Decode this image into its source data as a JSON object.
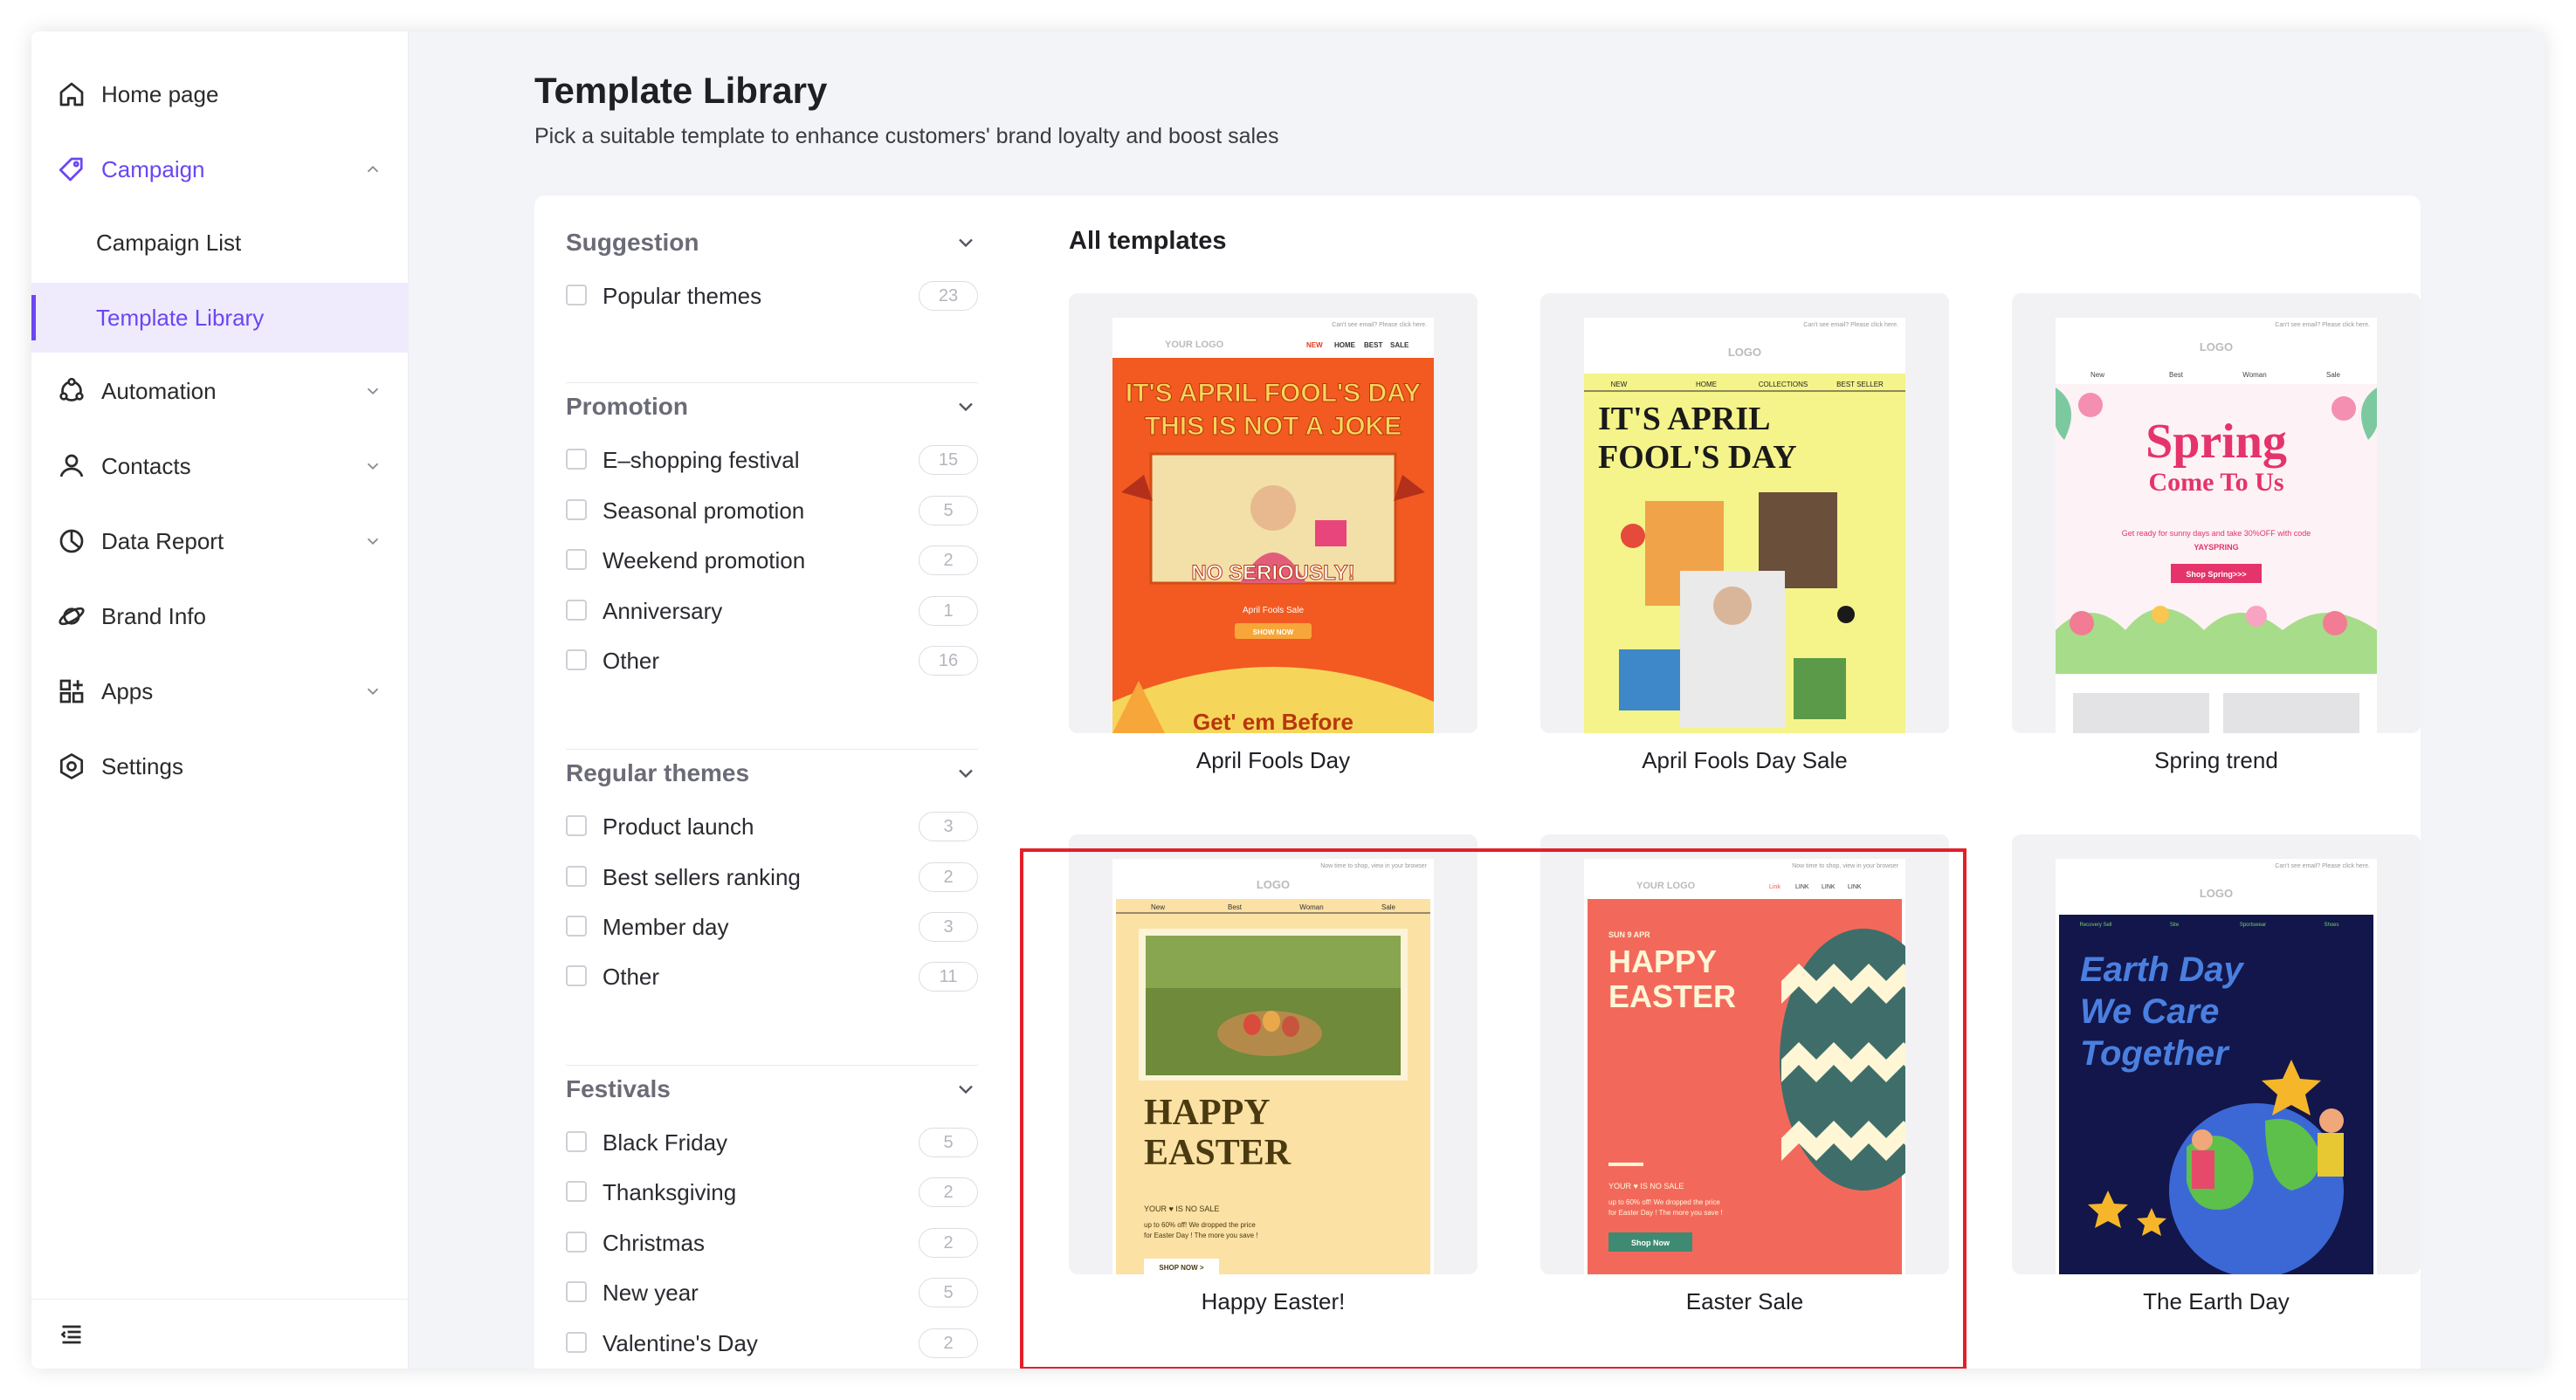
{
  "sidebar": {
    "items": [
      {
        "label": "Home page",
        "icon": "home-icon"
      },
      {
        "label": "Campaign",
        "icon": "tag-icon"
      },
      {
        "label": "Campaign List"
      },
      {
        "label": "Template Library"
      },
      {
        "label": "Automation",
        "icon": "automation-icon"
      },
      {
        "label": "Contacts",
        "icon": "user-icon"
      },
      {
        "label": "Data Report",
        "icon": "pie-chart-icon"
      },
      {
        "label": "Brand Info",
        "icon": "planet-icon"
      },
      {
        "label": "Apps",
        "icon": "apps-grid-icon"
      },
      {
        "label": "Settings",
        "icon": "gear-icon"
      }
    ],
    "accent_color": "#6b46f2"
  },
  "header": {
    "title": "Template Library",
    "subtitle": "Pick a suitable template to enhance customers' brand loyalty and boost sales"
  },
  "filters": {
    "groups": [
      {
        "title": "Suggestion",
        "options": [
          {
            "label": "Popular themes",
            "count": "23"
          }
        ]
      },
      {
        "title": "Promotion",
        "options": [
          {
            "label": "E–shopping festival",
            "count": "15"
          },
          {
            "label": "Seasonal promotion",
            "count": "5"
          },
          {
            "label": "Weekend promotion",
            "count": "2"
          },
          {
            "label": "Anniversary",
            "count": "1"
          },
          {
            "label": "Other",
            "count": "16"
          }
        ]
      },
      {
        "title": "Regular themes",
        "options": [
          {
            "label": "Product launch",
            "count": "3"
          },
          {
            "label": "Best sellers ranking",
            "count": "2"
          },
          {
            "label": "Member day",
            "count": "3"
          },
          {
            "label": "Other",
            "count": "11"
          }
        ]
      },
      {
        "title": "Festivals",
        "options": [
          {
            "label": "Black Friday",
            "count": "5"
          },
          {
            "label": "Thanksgiving",
            "count": "2"
          },
          {
            "label": "Christmas",
            "count": "2"
          },
          {
            "label": "New year",
            "count": "5"
          },
          {
            "label": "Valentine's Day",
            "count": "2"
          }
        ]
      }
    ]
  },
  "templates": {
    "section_title": "All templates",
    "items": [
      {
        "name": "April Fools Day",
        "preview": {
          "topline": "Can't see email? Please click here.",
          "logo": "YOUR LOGO",
          "nav": [
            "NEW",
            "HOME",
            "BEST",
            "SALE"
          ],
          "headline_1": "IT'S APRIL FOOL'S DAY",
          "headline_2": "THIS IS NOT A JOKE",
          "stamp": "NO SERIOUSLY!",
          "tagline": "April Fools Sale",
          "cta": "SHOW NOW",
          "footer": "Get' em Before"
        }
      },
      {
        "name": "April Fools Day Sale",
        "preview": {
          "topline": "Can't see email? Please click here.",
          "logo": "LOGO",
          "nav": [
            "NEW",
            "HOME",
            "COLLECTIONS",
            "BEST SELLER"
          ],
          "headline_1": "IT'S APRIL",
          "headline_2": "FOOL'S DAY"
        }
      },
      {
        "name": "Spring trend",
        "preview": {
          "topline": "Can't see email? Please click here.",
          "logo": "LOGO",
          "nav": [
            "New",
            "Best",
            "Woman",
            "Sale"
          ],
          "headline_1": "Spring",
          "headline_2": "Come To Us",
          "body": "Get ready for sunny days and take 30%OFF with code",
          "code": "YAYSPRING",
          "cta": "Shop Spring>>>"
        }
      },
      {
        "name": "Happy Easter!",
        "preview": {
          "topline": "Now time to shop, view in your browser",
          "logo": "LOGO",
          "nav": [
            "New",
            "Best",
            "Woman",
            "Sale"
          ],
          "headline_1": "HAPPY",
          "headline_2": "EASTER",
          "line_1": "YOUR ♥ IS NO SALE",
          "line_2": "up to 60% off! We dropped the price",
          "line_3": "for Easter Day ! The more you save !",
          "cta": "SHOP NOW >"
        }
      },
      {
        "name": "Easter Sale",
        "preview": {
          "topline": "Now time to shop, view in your browser",
          "logo": "YOUR LOGO",
          "nav": [
            "Link",
            "LINK",
            "LINK",
            "LINK"
          ],
          "date": "SUN 9 APR",
          "headline_1": "HAPPY",
          "headline_2": "EASTER",
          "line_1": "YOUR ♥ IS NO SALE",
          "line_2": "up to 60% off! We dropped the price",
          "line_3": "for Easter Day ! The more you save !",
          "cta": "Shop Now"
        }
      },
      {
        "name": "The Earth Day",
        "preview": {
          "topline": "Can't see email? Please click here.",
          "logo": "LOGO",
          "nav": [
            "Recovery Sell",
            "Site",
            "Sportswear",
            "Shoes"
          ],
          "headline_1": "Earth Day",
          "headline_2": "We Care",
          "headline_3": "Together"
        }
      }
    ],
    "highlight_color": "#e3202a"
  }
}
